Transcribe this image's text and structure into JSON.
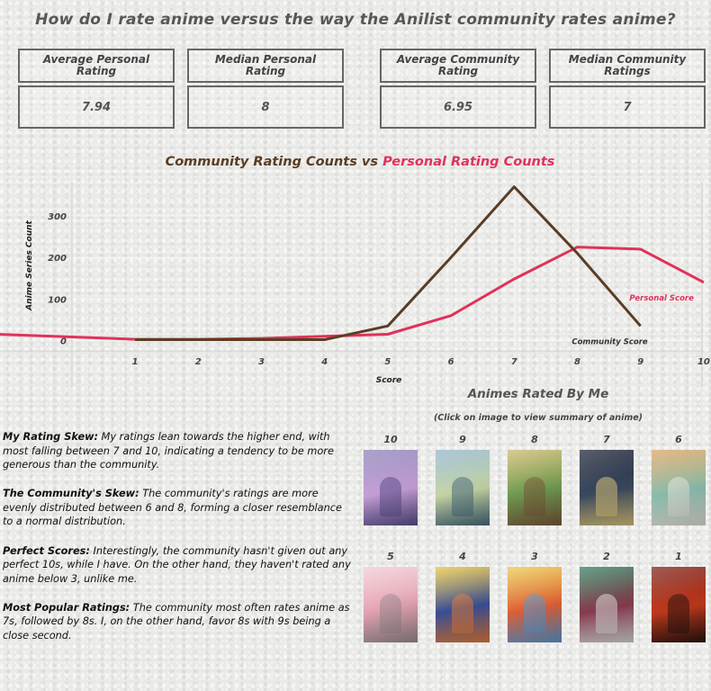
{
  "title": "How do I rate anime versus the way the Anilist community rates anime?",
  "kpis": [
    {
      "label": "Average Personal Rating",
      "value": "7.94"
    },
    {
      "label": "Median Personal Rating",
      "value": "8"
    },
    {
      "label": "Average Community Rating",
      "value": "6.95"
    },
    {
      "label": "Median Community Ratings",
      "value": "7"
    }
  ],
  "chart_title": {
    "part1": "Community Rating Counts",
    "joiner": "vs",
    "part2": "Personal Rating Counts"
  },
  "chart_data": {
    "type": "line",
    "xlabel": "Score",
    "ylabel": "Anime Series Count",
    "x_ticks": [
      "1",
      "2",
      "3",
      "4",
      "5",
      "6",
      "7",
      "8",
      "9",
      "10"
    ],
    "y_ticks": [
      "0",
      "100",
      "200",
      "300"
    ],
    "xlim": [
      0.5,
      10.5
    ],
    "ylim": [
      -25,
      380
    ],
    "grid": true,
    "series": [
      {
        "name": "Personal Score",
        "color": "#e0325a",
        "x": [
          0.5,
          1,
          2,
          3,
          4,
          5,
          6,
          7,
          8,
          9,
          10
        ],
        "y": [
          15,
          3,
          3,
          5,
          10,
          15,
          60,
          148,
          225,
          220,
          140
        ]
      },
      {
        "name": "Community Score",
        "color": "#5a3d23",
        "x": [
          1,
          2,
          3,
          4,
          5,
          6,
          7,
          8,
          9
        ],
        "y": [
          2,
          2,
          2,
          2,
          35,
          200,
          370,
          210,
          35
        ]
      }
    ]
  },
  "gallery": {
    "title": "Animes Rated By Me",
    "subtitle": "(Click on image to view summary of anime)",
    "items": [
      {
        "score": "10",
        "colors": [
          "#8a7fb5",
          "#c9a2d8",
          "#5b4f8c"
        ]
      },
      {
        "score": "9",
        "colors": [
          "#8fb3c9",
          "#c8d7a6",
          "#4a6b7d"
        ]
      },
      {
        "score": "8",
        "colors": [
          "#c9b56a",
          "#6f9c52",
          "#7a5a3a"
        ]
      },
      {
        "score": "7",
        "colors": [
          "#1b2233",
          "#3b4a60",
          "#d8c27a"
        ]
      },
      {
        "score": "6",
        "colors": [
          "#d9a25f",
          "#8bbfb0",
          "#e6e2d8"
        ]
      },
      {
        "score": "5",
        "colors": [
          "#f0c9d2",
          "#e6a4b4",
          "#9b8d90"
        ]
      },
      {
        "score": "4",
        "colors": [
          "#e7c23c",
          "#3a4f9a",
          "#e07b39"
        ]
      },
      {
        "score": "3",
        "colors": [
          "#e8c84a",
          "#e0603a",
          "#5a9ad0"
        ]
      },
      {
        "score": "2",
        "colors": [
          "#2f7d5b",
          "#8a3c4f",
          "#d8d8d8"
        ]
      },
      {
        "score": "1",
        "colors": [
          "#7a1f16",
          "#c23a1c",
          "#2b1410"
        ]
      }
    ]
  },
  "notes": [
    {
      "heading": "My Rating Skew:",
      "text": " My ratings lean towards the higher end, with most falling between 7 and 10, indicating a tendency to be more generous than the community."
    },
    {
      "heading": "The Community's Skew:",
      "text": " The community's ratings are more evenly distributed between 6 and 8, forming a closer resemblance to a normal distribution."
    },
    {
      "heading": "Perfect Scores:",
      "text": " Interestingly, the community hasn't given out any perfect 10s, while I have. On the other hand, they haven't rated any anime below 3, unlike me."
    },
    {
      "heading": "Most Popular Ratings:",
      "text": " The community most often rates anime as 7s, followed by 8s. I, on the other hand, favor 8s with 9s being a close second."
    }
  ]
}
